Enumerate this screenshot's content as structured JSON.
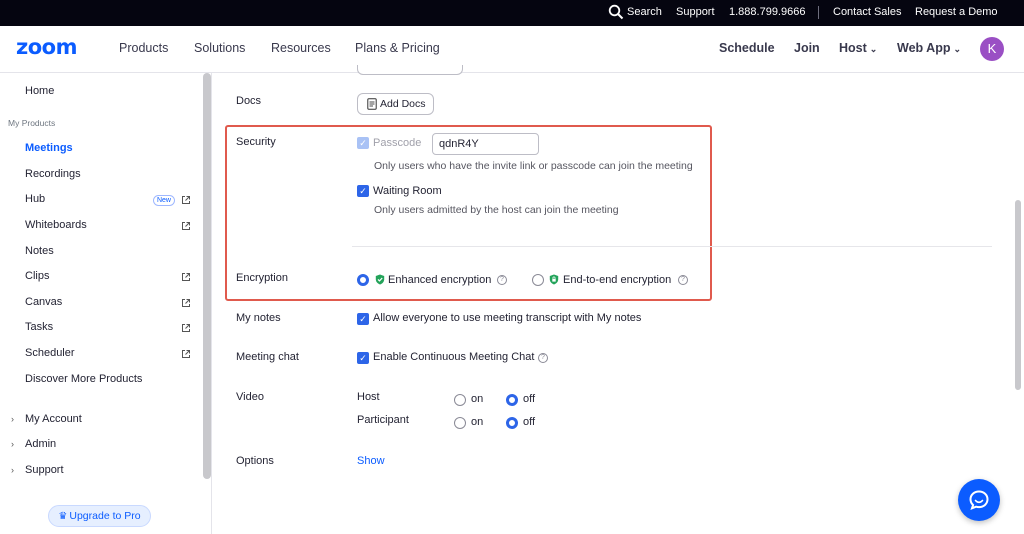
{
  "topbar": {
    "search_label": "Search",
    "support": "Support",
    "phone": "1.888.799.9666",
    "contact_sales": "Contact Sales",
    "request_demo": "Request a Demo"
  },
  "nav": {
    "logo": "zoom",
    "products": "Products",
    "solutions": "Solutions",
    "resources": "Resources",
    "plans": "Plans & Pricing",
    "schedule": "Schedule",
    "join": "Join",
    "host": "Host",
    "web_app": "Web App",
    "avatar_initial": "K"
  },
  "sidebar": {
    "home": "Home",
    "section_my_products": "My Products",
    "items": [
      {
        "label": "Meetings",
        "active": true,
        "external": false
      },
      {
        "label": "Recordings",
        "active": false,
        "external": false
      },
      {
        "label": "Hub",
        "active": false,
        "external": true,
        "badge": "New"
      },
      {
        "label": "Whiteboards",
        "active": false,
        "external": true
      },
      {
        "label": "Notes",
        "active": false,
        "external": false
      },
      {
        "label": "Clips",
        "active": false,
        "external": true
      },
      {
        "label": "Canvas",
        "active": false,
        "external": true
      },
      {
        "label": "Tasks",
        "active": false,
        "external": true
      },
      {
        "label": "Scheduler",
        "active": false,
        "external": true
      },
      {
        "label": "Discover More Products",
        "active": false,
        "external": false
      }
    ],
    "my_account": "My Account",
    "admin": "Admin",
    "support": "Support",
    "upgrade": "Upgrade to Pro"
  },
  "content": {
    "docs_label": "Docs",
    "add_docs": "Add Docs",
    "security_label": "Security",
    "passcode_label": "Passcode",
    "passcode_value": "qdnR4Y",
    "passcode_hint": "Only users who have the invite link or passcode can join the meeting",
    "waiting_room_label": "Waiting Room",
    "waiting_room_hint": "Only users admitted by the host can join the meeting",
    "encryption_label": "Encryption",
    "enhanced_encryption": "Enhanced encryption",
    "e2e_encryption": "End-to-end encryption",
    "my_notes_label": "My notes",
    "my_notes_option": "Allow everyone to use meeting transcript with My notes",
    "meeting_chat_label": "Meeting chat",
    "meeting_chat_option": "Enable Continuous Meeting Chat",
    "video_label": "Video",
    "host_label": "Host",
    "participant_label": "Participant",
    "on": "on",
    "off": "off",
    "options_label": "Options",
    "show_link": "Show"
  },
  "colors": {
    "accent": "#0b5cff",
    "highlight_border": "#e05a4d",
    "checkbox": "#2d65e8",
    "avatar": "#9a4fc4"
  }
}
